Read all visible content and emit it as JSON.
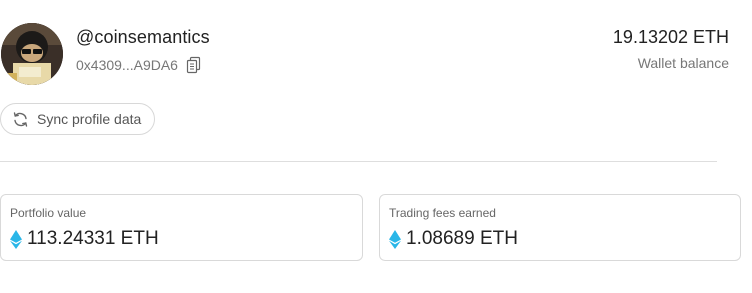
{
  "profile": {
    "username": "@coinsemantics",
    "address": "0x4309...A9DA6",
    "avatar_icon": "avatar-image",
    "copy_icon": "copy-icon"
  },
  "balance": {
    "value": "19.13202 ETH",
    "label": "Wallet balance"
  },
  "sync": {
    "label": "Sync profile data",
    "icon": "refresh-icon"
  },
  "cards": {
    "portfolio": {
      "label": "Portfolio value",
      "value": "113.24331 ETH",
      "icon": "ethereum-icon"
    },
    "fees": {
      "label": "Trading fees earned",
      "value": "1.08689 ETH",
      "icon": "ethereum-icon"
    }
  },
  "colors": {
    "eth_accent": "#29b6e8",
    "border": "#d9d9d9",
    "muted_text": "#777777"
  }
}
